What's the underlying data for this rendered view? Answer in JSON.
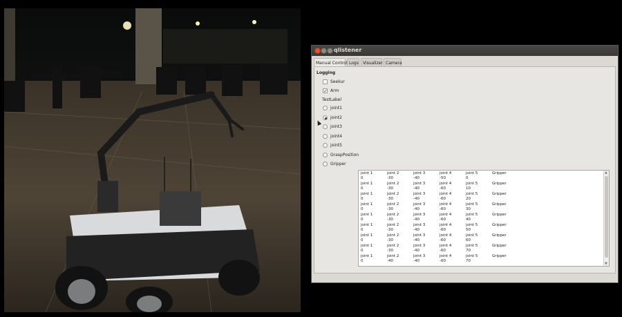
{
  "window": {
    "title": "qlistener"
  },
  "tabs": [
    "Manual Control",
    "Logs",
    "Visualizer",
    "Camera"
  ],
  "logging": {
    "heading": "Logging",
    "checkboxes": [
      {
        "label": "Seekur",
        "checked": false
      },
      {
        "label": "Arm",
        "checked": true
      }
    ],
    "test_label": "TestLabel",
    "radios": [
      {
        "label": "joint1",
        "selected": false
      },
      {
        "label": "joint2",
        "selected": true
      },
      {
        "label": "joint3",
        "selected": false
      },
      {
        "label": "joint4",
        "selected": false
      },
      {
        "label": "joint5",
        "selected": false
      },
      {
        "label": "GraspPosition",
        "selected": false
      },
      {
        "label": "Gripper",
        "selected": false
      }
    ]
  },
  "log_entries": [
    {
      "names": [
        "joint 1",
        "joint 2",
        "joint 3",
        "joint 4",
        "joint 5",
        "Gripper"
      ],
      "values": [
        "0",
        "-30",
        "-40",
        "-50",
        "0"
      ]
    },
    {
      "names": [
        "joint 1",
        "joint 2",
        "joint 3",
        "joint 4",
        "joint 5",
        "Gripper"
      ],
      "values": [
        "0",
        "-30",
        "-40",
        "-60",
        "10"
      ]
    },
    {
      "names": [
        "joint 1",
        "joint 2",
        "joint 3",
        "joint 4",
        "joint 5",
        "Gripper"
      ],
      "values": [
        "0",
        "-30",
        "-40",
        "-60",
        "20"
      ]
    },
    {
      "names": [
        "joint 1",
        "joint 2",
        "joint 3",
        "joint 4",
        "joint 5",
        "Gripper"
      ],
      "values": [
        "0",
        "-30",
        "-40",
        "-60",
        "30"
      ]
    },
    {
      "names": [
        "joint 1",
        "joint 2",
        "joint 3",
        "joint 4",
        "joint 5",
        "Gripper"
      ],
      "values": [
        "0",
        "-30",
        "-40",
        "-60",
        "40"
      ]
    },
    {
      "names": [
        "joint 1",
        "joint 2",
        "joint 3",
        "joint 4",
        "joint 5",
        "Gripper"
      ],
      "values": [
        "0",
        "-30",
        "-40",
        "-60",
        "50"
      ]
    },
    {
      "names": [
        "joint 1",
        "joint 2",
        "joint 3",
        "joint 4",
        "joint 5",
        "Gripper"
      ],
      "values": [
        "0",
        "-30",
        "-40",
        "-60",
        "60"
      ]
    },
    {
      "names": [
        "joint 1",
        "joint 2",
        "joint 3",
        "joint 4",
        "joint 5",
        "Gripper"
      ],
      "values": [
        "0",
        "-30",
        "-40",
        "-60",
        "70"
      ]
    },
    {
      "names": [
        "joint 1",
        "joint 2",
        "joint 3",
        "joint 4",
        "joint 5",
        "Gripper"
      ],
      "values": [
        "0",
        "-40",
        "-40",
        "-60",
        "70"
      ]
    }
  ]
}
